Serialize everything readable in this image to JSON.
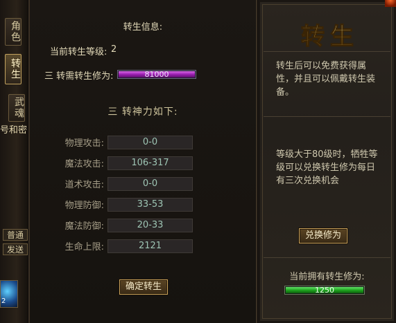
{
  "left_tabs": [
    {
      "label": "角色",
      "active": false
    },
    {
      "label": "转生",
      "active": true
    },
    {
      "label": "武魂",
      "active": false
    }
  ],
  "left_cut_text": "号和密",
  "left_buttons": [
    "普通",
    "发送"
  ],
  "left_slot_count": "2",
  "main": {
    "title": "转生信息:",
    "current_level_label": "当前转生等级:",
    "current_level_value": "2",
    "required_label": "三 转需转生修为:",
    "required_value": "81000",
    "required_fill_fraction": 1.0,
    "power_title": "三 转神力如下:",
    "stats": [
      {
        "name": "物理攻击:",
        "value": "0-0"
      },
      {
        "name": "魔法攻击:",
        "value": "106-317"
      },
      {
        "name": "道术攻击:",
        "value": "0-0"
      },
      {
        "name": "物理防御:",
        "value": "33-53"
      },
      {
        "name": "魔法防御:",
        "value": "20-33"
      },
      {
        "name": "生命上限:",
        "value": "2121"
      }
    ],
    "confirm_button": "确定转生"
  },
  "side": {
    "title": "转生",
    "description": "转生后可以免费获得属性，并且可以佩戴转生装备。",
    "exchange_info": "等级大于80级时，牺牲等级可以兑换转生修为每日有三次兑换机会",
    "exchange_button": "兑换修为",
    "owned_label": "当前拥有转生修为:",
    "owned_value": "1250",
    "owned_fill_fraction": 1.0
  },
  "colors": {
    "required_bar": "#9b1fb2",
    "owned_bar": "#1fa51f",
    "accent_gold": "#c9a25a"
  }
}
